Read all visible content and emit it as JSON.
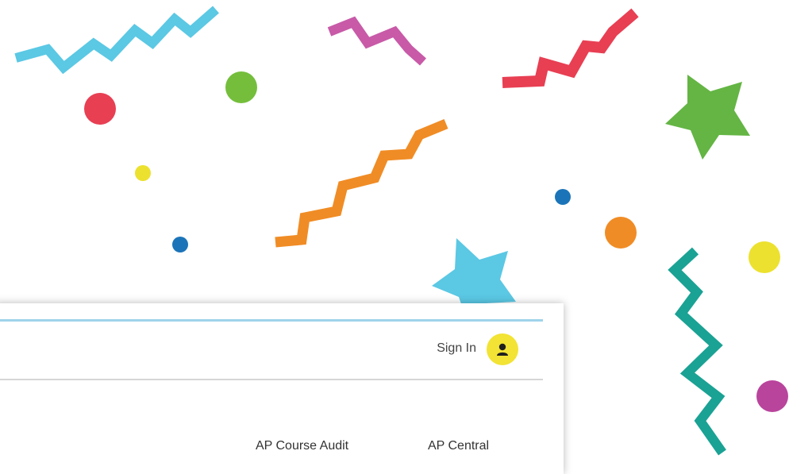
{
  "header": {
    "sign_in_label": "Sign In"
  },
  "nav": {
    "items": [
      {
        "label": "AP Course Audit"
      },
      {
        "label": "AP Central"
      }
    ]
  },
  "icons": {
    "account": "user-account-icon"
  },
  "colors": {
    "confetti_blue": "#5bc8e4",
    "confetti_magenta": "#c85aa8",
    "confetti_red": "#e83f53",
    "confetti_green": "#64b544",
    "confetti_yellow": "#ece12e",
    "confetti_navy_dot": "#1b74b8",
    "confetti_orange": "#f08c25",
    "confetti_teal": "#1aa294",
    "confetti_purple": "#b9449c",
    "avatar_bg": "#f2e335",
    "top_rule": "#9ed3ea"
  }
}
